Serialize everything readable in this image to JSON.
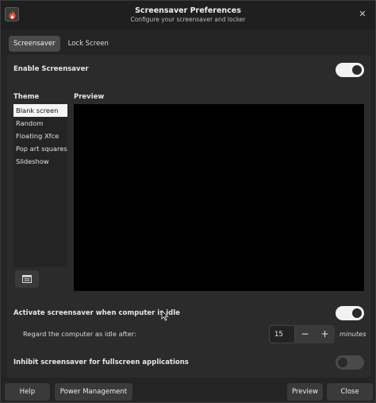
{
  "window": {
    "title": "Screensaver Preferences",
    "subtitle": "Configure your screensaver and locker",
    "app_icon": "screensaver-flame-icon",
    "close_icon": "close-icon"
  },
  "tabs": [
    {
      "label": "Screensaver",
      "active": true
    },
    {
      "label": "Lock Screen",
      "active": false
    }
  ],
  "enable_screensaver": {
    "label": "Enable Screensaver",
    "on": true
  },
  "theme": {
    "heading": "Theme",
    "items": [
      "Blank screen",
      "Random",
      "Floating Xfce",
      "Pop art squares",
      "Slideshow"
    ],
    "selected": "Blank screen",
    "configure_icon": "configure-icon"
  },
  "preview": {
    "heading": "Preview"
  },
  "idle": {
    "label": "Activate screensaver when computer is idle",
    "on": true,
    "regard_label": "Regard the computer as idle after:",
    "value": "15",
    "minus": "−",
    "plus": "+",
    "unit": "minutes"
  },
  "inhibit": {
    "label": "Inhibit screensaver for fullscreen applications",
    "on": false
  },
  "footer": {
    "help": "Help",
    "power": "Power Management",
    "preview": "Preview",
    "close": "Close"
  },
  "colors": {
    "accent_switch_on": "#f2f2f2",
    "switch_off": "#4a4a4a",
    "preview_bg": "#000000"
  }
}
